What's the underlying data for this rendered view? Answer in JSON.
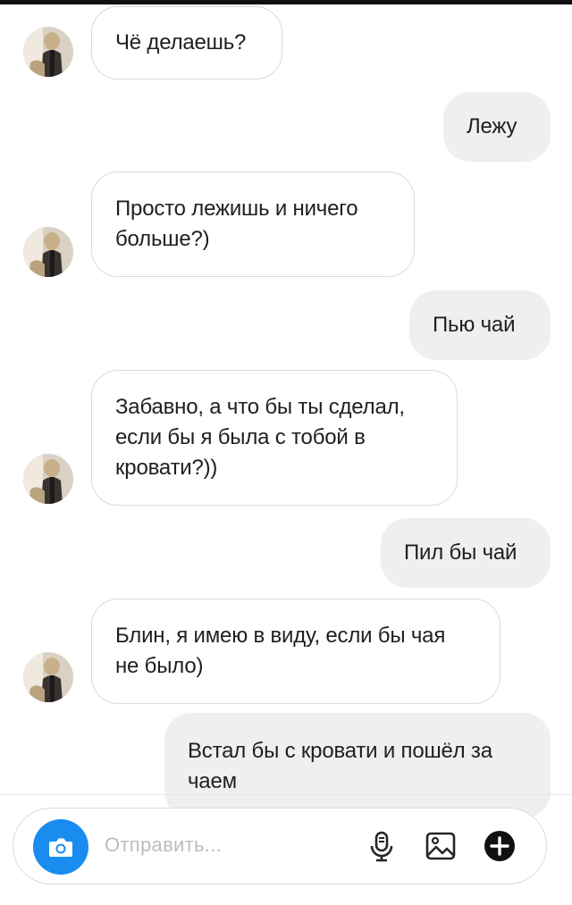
{
  "messages": [
    {
      "side": "in",
      "text": "Чё делаешь?"
    },
    {
      "side": "out",
      "text": "Лежу"
    },
    {
      "side": "in",
      "text": "Просто лежишь и ничего\nбольше?)"
    },
    {
      "side": "out",
      "text": "Пью чай"
    },
    {
      "side": "in",
      "text": "Забавно, а что бы ты сделал,\nесли бы я была с тобой в\nкровати?))"
    },
    {
      "side": "out",
      "text": "Пил бы чай"
    },
    {
      "side": "in",
      "text": "Блин, я имею в виду, если бы чая\nне было)"
    },
    {
      "side": "out",
      "text": "Встал бы с кровати и пошёл за\nчаем"
    }
  ],
  "composer": {
    "placeholder": "Отправить...",
    "camera_icon": "camera-icon",
    "mic_icon": "microphone-icon",
    "gallery_icon": "gallery-icon",
    "more_icon": "plus-circle-icon"
  },
  "colors": {
    "accent": "#1a8cf0",
    "incoming_bg": "#ffffff",
    "incoming_border": "#dadada",
    "outgoing_bg": "#efefef",
    "text": "#1f1f1f"
  }
}
